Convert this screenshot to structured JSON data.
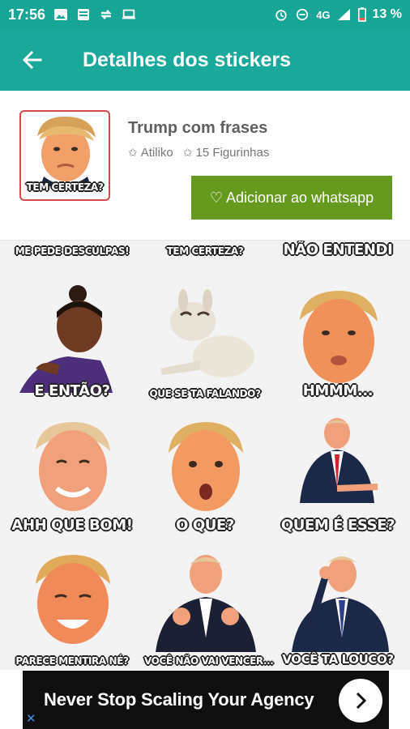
{
  "status_bar": {
    "time": "17:56",
    "network": "4G",
    "battery": "13 %",
    "icons_left": [
      "image-icon",
      "notes-icon",
      "sync-icon",
      "laptop-icon"
    ],
    "icons_right": [
      "alarm-icon",
      "do-not-disturb-icon",
      "signal-icon",
      "battery-icon"
    ]
  },
  "app_bar": {
    "title": "Detalhes dos stickers",
    "back_icon": "back-arrow-icon"
  },
  "pack": {
    "name": "Trump com frases",
    "author": "Atiliko",
    "count": "15 Figurinhas",
    "thumb_caption": "TEM CERTEZA?",
    "add_button": "♡ Adicionar ao whatsapp"
  },
  "stickers": [
    {
      "caption": "ME PEDE DESCULPAS!"
    },
    {
      "caption": "TEM CERTEZA?"
    },
    {
      "caption": "NÃO ENTENDI"
    },
    {
      "caption": "E ENTÃO?"
    },
    {
      "caption": "QUE SE TA FALANDO?"
    },
    {
      "caption": "HMMM..."
    },
    {
      "caption": "AHH QUE BOM!"
    },
    {
      "caption": "O QUE?"
    },
    {
      "caption": "QUEM É ESSE?"
    },
    {
      "caption": "PARECE MENTIRA NÉ?"
    },
    {
      "caption": "VOCÊ NÃO VAI VENCER..."
    },
    {
      "caption": "VOCÊ TA LOUCO?"
    }
  ],
  "ad": {
    "text": "Never Stop Scaling Your Agency",
    "close": "✕"
  },
  "colors": {
    "status_bar": "#17a596",
    "app_bar": "#19a89a",
    "add_button": "#669a1e",
    "thumb_border": "#d7454e"
  }
}
